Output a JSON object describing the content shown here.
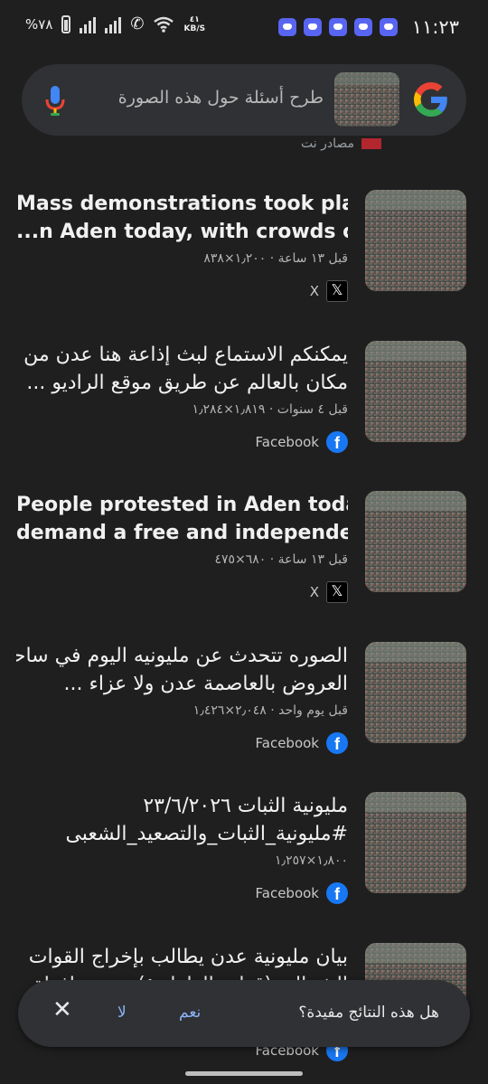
{
  "status_bar": {
    "time": "١١:٢٣",
    "battery": "%٧٨",
    "speed_value": "٤١",
    "speed_unit": "KB/S"
  },
  "search": {
    "placeholder": "طرح أسئلة حول هذه الصورة"
  },
  "sources_label": "مصادر نت",
  "results": [
    {
      "title_line1": "Mass demonstrations took place",
      "title_line2": "...n Aden today, with crowds calling",
      "meta": "قبل ١٣ ساعة · ١٫٢٠٠×٨٣٨",
      "source": "X"
    },
    {
      "title_line1": "يمكنكم الاستماع لبث إذاعة هنا عدن من أي",
      "title_line2": "مكان بالعالم عن طريق موقع الراديو ...",
      "meta": "قبل ٤ سنوات · ١٫٨١٩×١٫٢٨٤",
      "source": "Facebook"
    },
    {
      "title_line1": "People protested in Aden today to",
      "title_line2": "demand a free and independent ...",
      "meta": "قبل ١٣ ساعة · ٦٨٠×٤٧٥",
      "source": "X"
    },
    {
      "title_line1": "الصوره تتحدث عن مليونيه اليوم في ساحه",
      "title_line2": "العروض بالعاصمة عدن ولا عزاء ...",
      "meta": "قبل يوم واحد · ٢٫٠٤٨×١٫٤٢٦",
      "source": "Facebook"
    },
    {
      "title_line1": "مليونية الثبات ٢٣/٦/٢٠٢٦",
      "title_line2": "#مليونية_الثبات_والتصعيد_الشعبى",
      "meta": "١٫٨٠٠×١٫٢٥٧",
      "source": "Facebook"
    },
    {
      "title_line1": "بيان مليونية عدن يطالب بإخراج القوات",
      "title_line2": "الشمالية (قوات الطوارئ) من محافظة",
      "source": "Facebook"
    }
  ],
  "feedback": {
    "question": "هل هذه النتائج مفيدة؟",
    "yes": "نعم",
    "no": "لا",
    "close": "✕"
  },
  "colors": {
    "background": "#1f1f1f",
    "surface": "#303134",
    "accent_link": "#8ab4f8",
    "facebook": "#1877F2",
    "discord": "#5865F2"
  }
}
